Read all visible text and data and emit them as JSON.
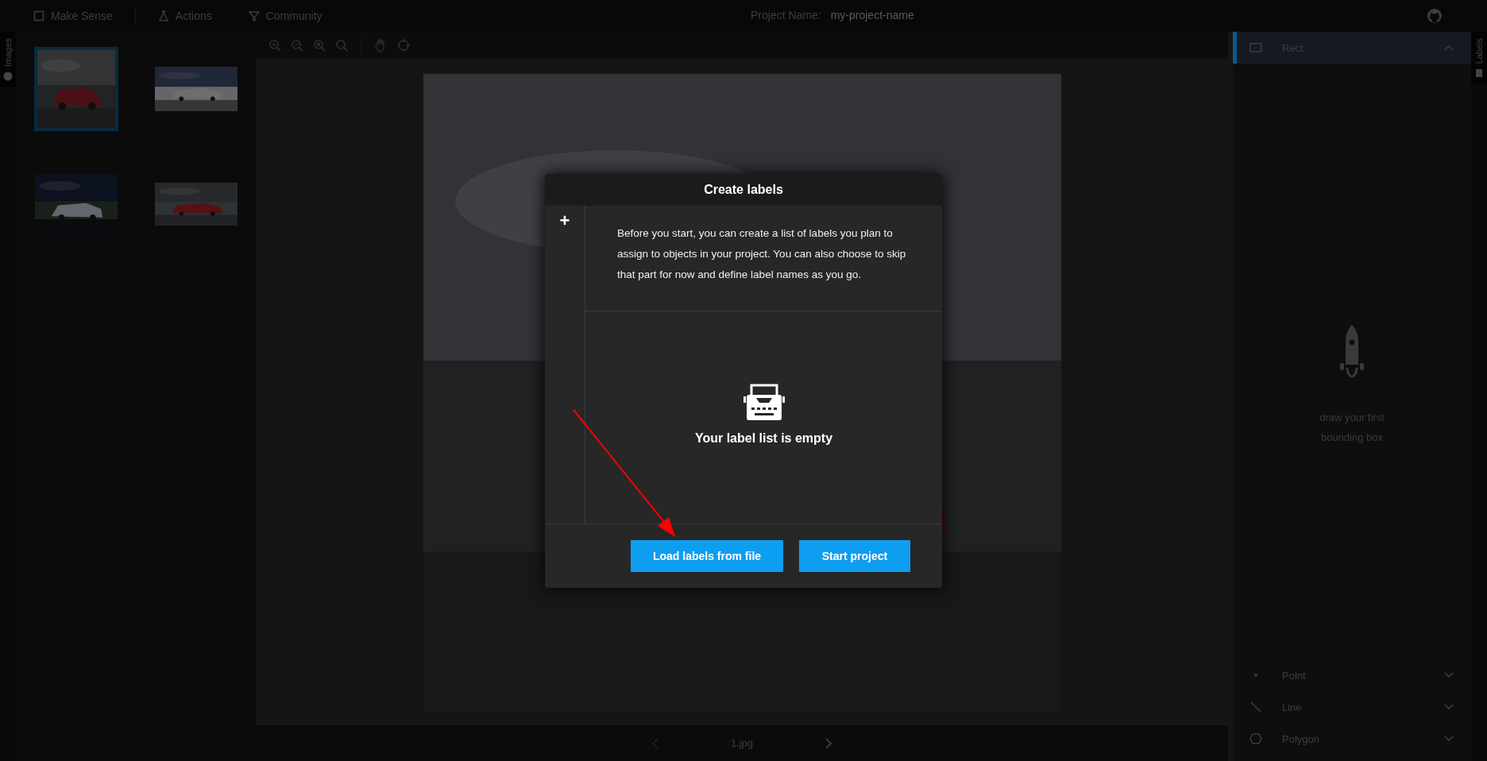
{
  "top_bar": {
    "logo": "Make Sense",
    "menu": [
      {
        "label": "Actions",
        "kind": "actions"
      },
      {
        "label": "Community",
        "kind": "community"
      }
    ],
    "project_name_label": "Project Name:",
    "project_name": "my-project-name"
  },
  "left_tab": {
    "label": "Images"
  },
  "images": [
    {
      "selected": true,
      "kind": "red-car"
    },
    {
      "selected": false,
      "kind": "white-car"
    },
    {
      "selected": false,
      "kind": "night-car"
    },
    {
      "selected": false,
      "kind": "red-sedan"
    }
  ],
  "bottom_bar": {
    "file_name": "1.jpg"
  },
  "right_tab": {
    "label": "Labels"
  },
  "label_tools": [
    {
      "label": "Rect",
      "kind": "rect",
      "selected": true,
      "expanded": true
    },
    {
      "label": "Point",
      "kind": "point",
      "selected": false,
      "expanded": false
    },
    {
      "label": "Line",
      "kind": "line",
      "selected": false,
      "expanded": false
    },
    {
      "label": "Polygon",
      "kind": "polygon",
      "selected": false,
      "expanded": false
    }
  ],
  "empty_hint": "draw your first bounding box",
  "modal": {
    "title": "Create labels",
    "add_button": "+",
    "description": "Before you start, you can create a list of labels you plan to assign to objects in your project. You can also choose to skip that part for now and define label names as you go.",
    "empty_text": "Your label list is empty",
    "buttons": [
      {
        "label": "Load labels from file"
      },
      {
        "label": "Start project"
      }
    ]
  }
}
